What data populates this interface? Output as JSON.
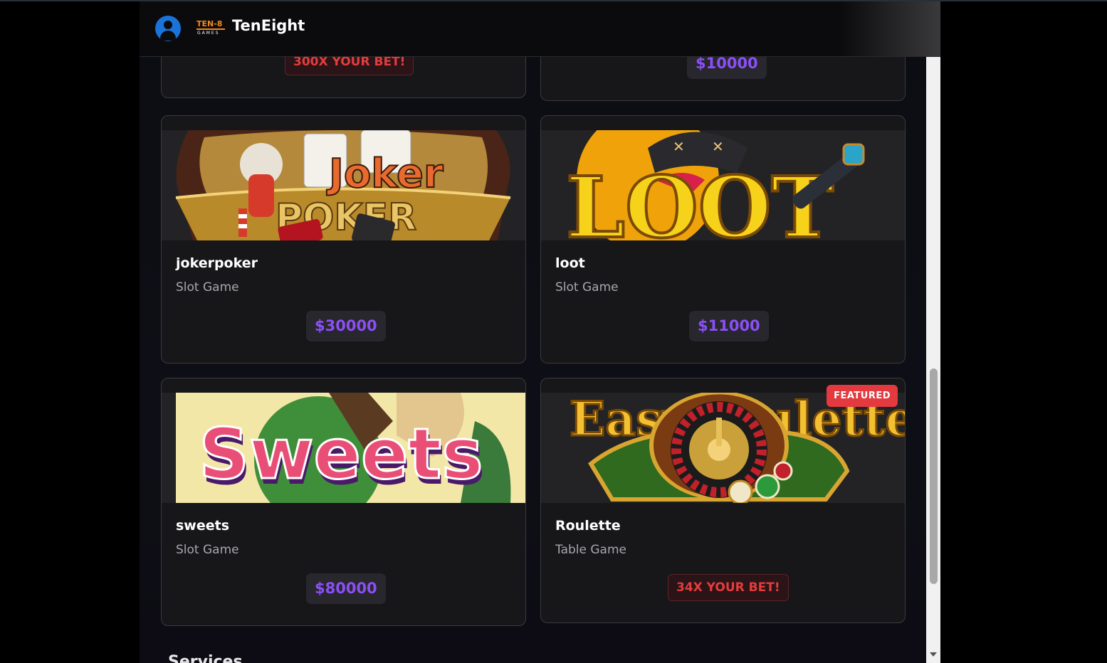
{
  "header": {
    "brand_mark_top": "TEN-8",
    "brand_mark_bottom": "GAMES",
    "brand_name": "TenEight"
  },
  "partial_cards": {
    "left_badge": "300X YOUR BET!",
    "right_price": "$10000"
  },
  "games": [
    {
      "title": "jokerpoker",
      "category": "Slot Game",
      "prize": "$30000",
      "art_text": [
        "Joker",
        "POKER"
      ]
    },
    {
      "title": "loot",
      "category": "Slot Game",
      "prize": "$11000",
      "art_text": [
        "LOOT"
      ]
    },
    {
      "title": "sweets",
      "category": "Slot Game",
      "prize": "$80000",
      "art_text": [
        "Sweets"
      ]
    },
    {
      "title": "Roulette",
      "category": "Table Game",
      "badge": "34X YOUR BET!",
      "featured_label": "FEATURED",
      "art_text": [
        "EasyRoulette"
      ]
    }
  ],
  "next_section_heading": "Services",
  "colors": {
    "accent_purple": "#8b4ff5",
    "bet_red": "#e53c3c",
    "featured_red": "#e23a3f",
    "avatar_blue": "#1a73d9",
    "brand_orange": "#f28a1c"
  },
  "icons": {
    "avatar": "user-circle-icon",
    "scroll_down": "triangle-down-icon"
  }
}
